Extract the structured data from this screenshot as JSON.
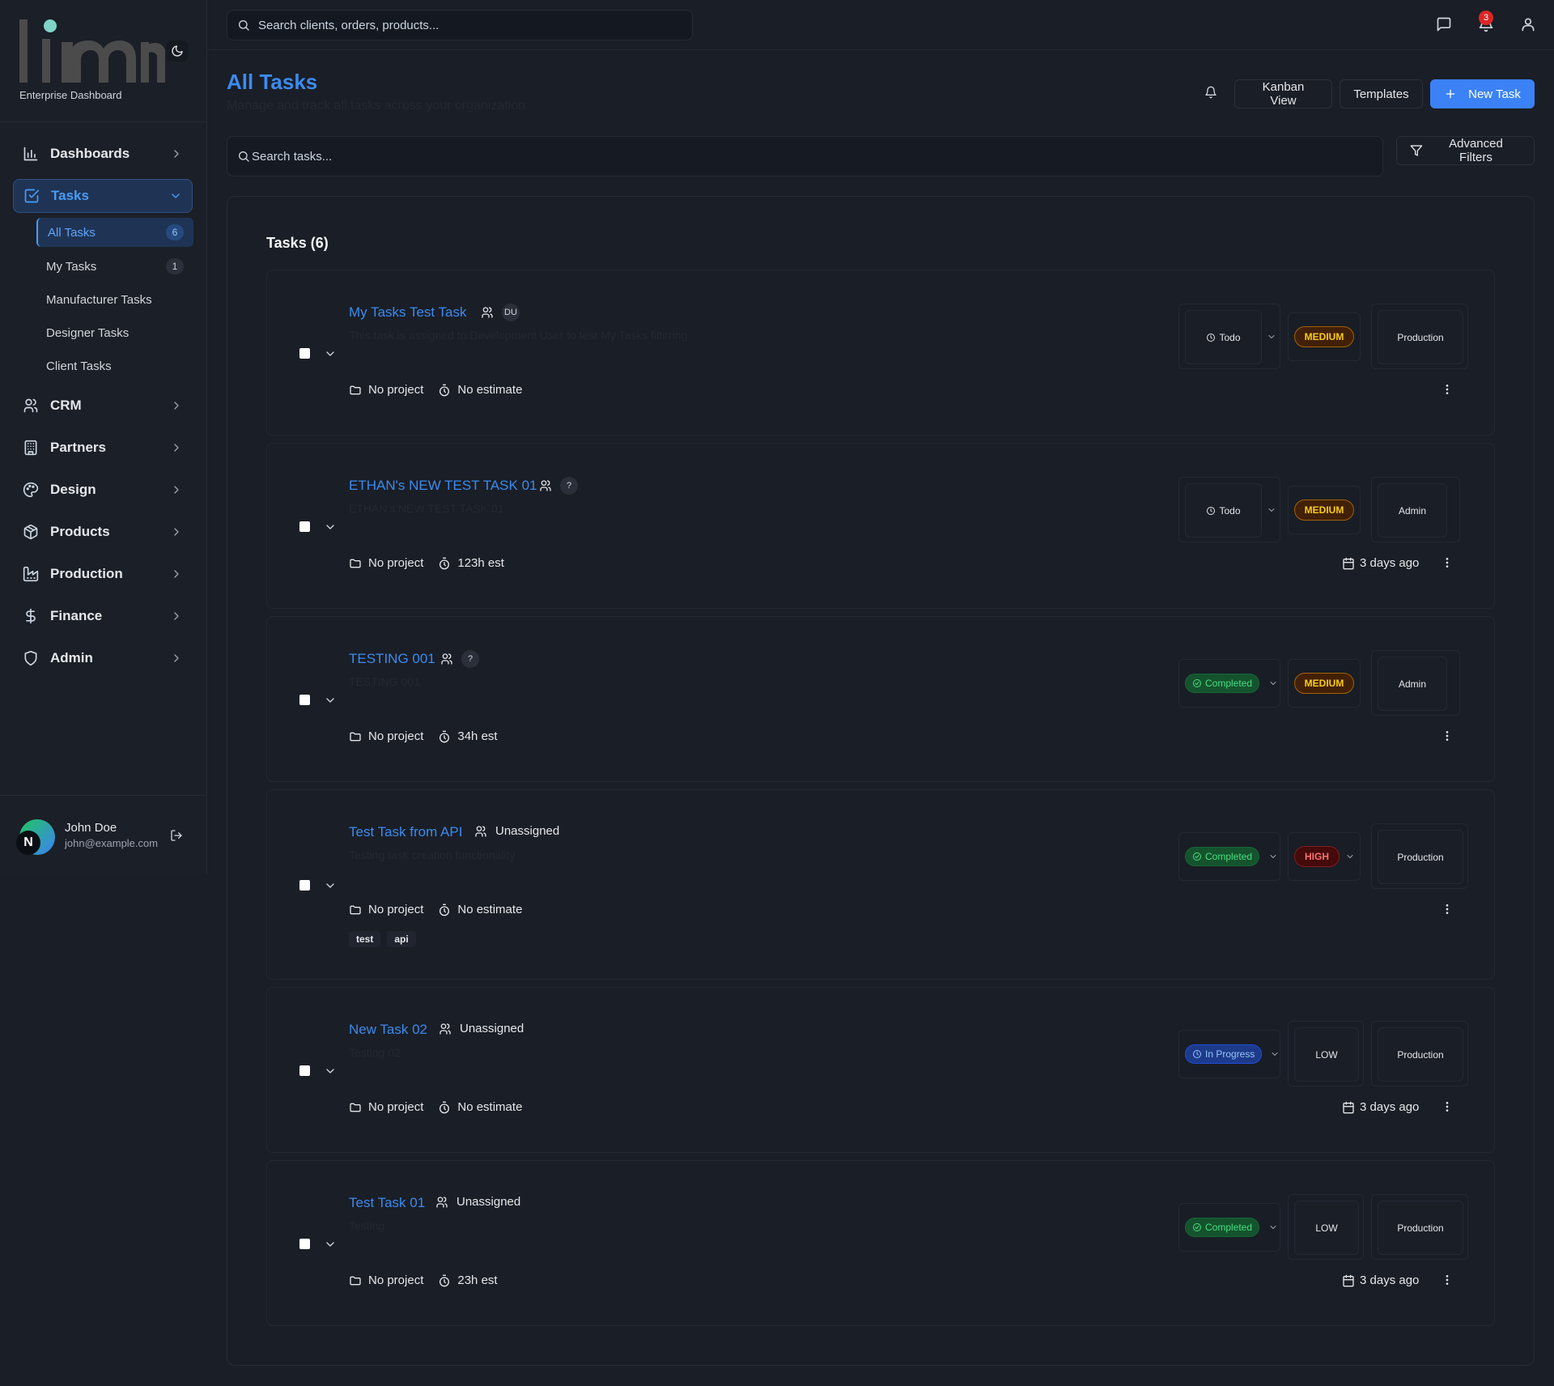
{
  "brand": {
    "subtitle": "Enterprise Dashboard"
  },
  "search": {
    "placeholder": "Search clients, orders, products..."
  },
  "notifications": {
    "count": "3"
  },
  "sidebar": {
    "items": [
      {
        "label": "Dashboards",
        "icon": "bar-chart-icon"
      },
      {
        "label": "Tasks",
        "icon": "check-square-icon",
        "active": true
      },
      {
        "label": "CRM",
        "icon": "users-icon"
      },
      {
        "label": "Partners",
        "icon": "building-icon"
      },
      {
        "label": "Design",
        "icon": "palette-icon"
      },
      {
        "label": "Products",
        "icon": "package-icon"
      },
      {
        "label": "Production",
        "icon": "factory-icon"
      },
      {
        "label": "Finance",
        "icon": "dollar-icon"
      },
      {
        "label": "Admin",
        "icon": "shield-icon"
      }
    ],
    "tasks_sub": [
      {
        "label": "All Tasks",
        "count": "6",
        "active": true
      },
      {
        "label": "My Tasks",
        "count": "1"
      },
      {
        "label": "Manufacturer Tasks"
      },
      {
        "label": "Designer Tasks"
      },
      {
        "label": "Client Tasks"
      }
    ]
  },
  "user": {
    "name": "John Doe",
    "email": "john@example.com",
    "avatar_initial": "N"
  },
  "header": {
    "title": "All Tasks",
    "subtitle": "Manage and track all tasks across your organization",
    "kanban_label": "Kanban View",
    "templates_label": "Templates",
    "new_task_label": "New Task"
  },
  "filters": {
    "search_placeholder": "Search tasks...",
    "advanced_label": "Advanced Filters"
  },
  "tasks_panel": {
    "title": "Tasks (6)"
  },
  "tasks": [
    {
      "title": "My Tasks Test Task",
      "assignee": "DU",
      "description": "This task is assigned to Development User to test My Tasks filtering",
      "project": "No project",
      "estimate": "No estimate",
      "status": "Todo",
      "priority": "MEDIUM",
      "department": "Production",
      "date": ""
    },
    {
      "title": "ETHAN's NEW TEST TASK 01",
      "assignee": "?",
      "description": "ETHAN's NEW TEST TASK 01",
      "project": "No project",
      "estimate": "123h est",
      "status": "Todo",
      "priority": "MEDIUM",
      "department": "Admin",
      "date": "3 days ago"
    },
    {
      "title": "TESTING 001",
      "assignee": "?",
      "description": "TESTING 001",
      "project": "No project",
      "estimate": "34h est",
      "status": "Completed",
      "priority": "MEDIUM",
      "department": "Admin",
      "date": ""
    },
    {
      "title": "Test Task from API",
      "assignee": "Unassigned",
      "description": "Testing task creation functionality",
      "project": "No project",
      "estimate": "No estimate",
      "status": "Completed",
      "priority": "HIGH",
      "department": "Production",
      "date": "",
      "tags": [
        "test",
        "api"
      ]
    },
    {
      "title": "New Task 02",
      "assignee": "Unassigned",
      "description": "Testing 02",
      "project": "No project",
      "estimate": "No estimate",
      "status": "In Progress",
      "priority": "LOW",
      "department": "Production",
      "date": "3 days ago"
    },
    {
      "title": "Test Task 01",
      "assignee": "Unassigned",
      "description": "Testing",
      "project": "No project",
      "estimate": "23h est",
      "status": "Completed",
      "priority": "LOW",
      "department": "Production",
      "date": "3 days ago"
    }
  ],
  "colors": {
    "accent": "#3b82f6",
    "background": "#1a1e26",
    "completed": "#4ade80",
    "medium": "#facc15",
    "high": "#f87171"
  }
}
